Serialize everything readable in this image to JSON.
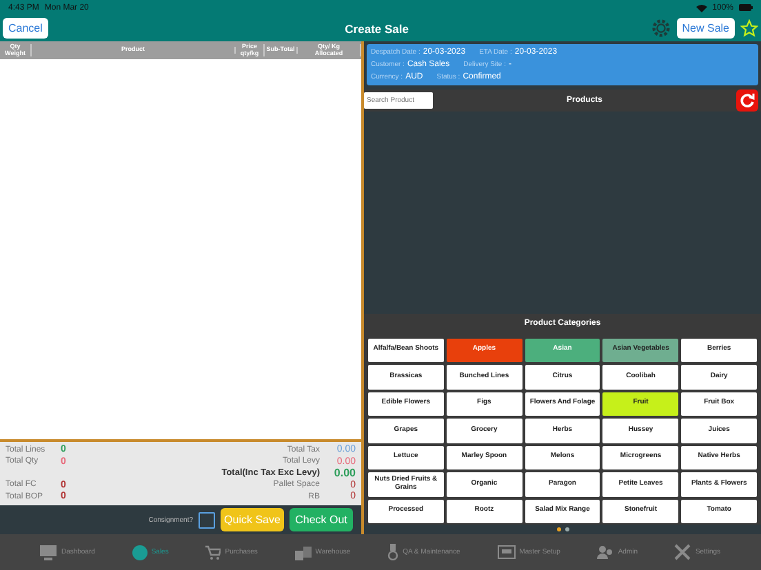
{
  "status_bar": {
    "time": "4:43 PM",
    "date": "Mon Mar 20",
    "battery_text": "100%"
  },
  "header": {
    "cancel": "Cancel",
    "title": "Create Sale",
    "new_sale": "New Sale"
  },
  "table": {
    "columns": [
      "Qty\nWeight",
      "Product",
      "Price\nqty/kg",
      "Sub-Total",
      "Qty/ Kg\nAllocated"
    ]
  },
  "totals": [
    {
      "left": {
        "label": "Total Lines",
        "value": "0",
        "color": "#2e9e5b"
      },
      "right": {
        "label": "Total Tax",
        "value": "0.00",
        "color": "#6a9fd8",
        "bold": false
      }
    },
    {
      "left": {
        "label": "Total Qty",
        "value": "0",
        "color": "#e8697a"
      },
      "right": {
        "label": "Total Levy",
        "value": "0.00",
        "color": "#e8697a",
        "bold": false
      }
    },
    {
      "right": {
        "label": "Total(Inc Tax Exc Levy)",
        "value": "0.00",
        "color": "#2e9e5b",
        "bold": true
      }
    },
    {
      "left": {
        "label": "Total FC",
        "value": "0",
        "color": "#b03030"
      },
      "right": {
        "label": "Pallet Space",
        "value": "0",
        "color": "#b03030",
        "bold": false
      }
    },
    {
      "left": {
        "label": "Total BOP",
        "value": "0",
        "color": "#b03030"
      },
      "right": {
        "label": "RB",
        "value": "0",
        "color": "#b03030",
        "bold": false
      }
    }
  ],
  "footer": {
    "consignment_label": "Consignment?",
    "consignment_checked": false,
    "quick_save": "Quick Save",
    "check_out": "Check Out"
  },
  "info": [
    [
      {
        "label": "Despatch Date :",
        "value": "20-03-2023"
      },
      {
        "label": "ETA Date :",
        "value": "20-03-2023"
      }
    ],
    [
      {
        "label": "Customer :",
        "value": "Cash Sales"
      },
      {
        "label": "Delivery Site :",
        "value": "-"
      }
    ],
    [
      {
        "label": "Currency :",
        "value": "AUD"
      },
      {
        "label": "Status :",
        "value": "Confirmed"
      }
    ]
  ],
  "products": {
    "search_placeholder": "Search Product",
    "title": "Products"
  },
  "categories": {
    "title": "Product Categories",
    "items": [
      {
        "label": "Alfalfa/Bean Shoots",
        "color": "#ffffff"
      },
      {
        "label": "Apples",
        "color": "#e8400c"
      },
      {
        "label": "Asian",
        "color": "#4caf7d"
      },
      {
        "label": "Asian Vegetables",
        "color": "#6fae90"
      },
      {
        "label": "Berries",
        "color": "#ffffff"
      },
      {
        "label": "Brassicas",
        "color": "#ffffff"
      },
      {
        "label": "Bunched Lines",
        "color": "#ffffff"
      },
      {
        "label": "Citrus",
        "color": "#ffffff"
      },
      {
        "label": "Coolibah",
        "color": "#ffffff"
      },
      {
        "label": "Dairy",
        "color": "#ffffff"
      },
      {
        "label": "Edible Flowers",
        "color": "#ffffff"
      },
      {
        "label": "Figs",
        "color": "#ffffff"
      },
      {
        "label": "Flowers And Folage",
        "color": "#ffffff"
      },
      {
        "label": "Fruit",
        "color": "#c6f01a"
      },
      {
        "label": "Fruit Box",
        "color": "#ffffff"
      },
      {
        "label": "Grapes",
        "color": "#ffffff"
      },
      {
        "label": "Grocery",
        "color": "#ffffff"
      },
      {
        "label": "Herbs",
        "color": "#ffffff"
      },
      {
        "label": "Hussey",
        "color": "#ffffff"
      },
      {
        "label": "Juices",
        "color": "#ffffff"
      },
      {
        "label": "Lettuce",
        "color": "#ffffff"
      },
      {
        "label": "Marley Spoon",
        "color": "#ffffff"
      },
      {
        "label": "Melons",
        "color": "#ffffff"
      },
      {
        "label": "Microgreens",
        "color": "#ffffff"
      },
      {
        "label": "Native Herbs",
        "color": "#ffffff"
      },
      {
        "label": "Nuts Dried Fruits & Grains",
        "color": "#ffffff"
      },
      {
        "label": "Organic",
        "color": "#ffffff"
      },
      {
        "label": "Paragon",
        "color": "#ffffff"
      },
      {
        "label": "Petite Leaves",
        "color": "#ffffff"
      },
      {
        "label": "Plants & Flowers",
        "color": "#ffffff"
      },
      {
        "label": "Processed",
        "color": "#ffffff"
      },
      {
        "label": "Rootz",
        "color": "#ffffff"
      },
      {
        "label": "Salad Mix Range",
        "color": "#ffffff"
      },
      {
        "label": "Stonefruit",
        "color": "#ffffff"
      },
      {
        "label": "Tomato",
        "color": "#ffffff"
      }
    ],
    "pages": [
      {
        "selected": true
      },
      {
        "selected": false
      }
    ]
  },
  "tab_bar": [
    {
      "label": "Dashboard",
      "selected": false
    },
    {
      "label": "Sales",
      "selected": true
    },
    {
      "label": "Purchases",
      "selected": false
    },
    {
      "label": "Warehouse",
      "selected": false
    },
    {
      "label": "QA & Maintenance",
      "selected": false
    },
    {
      "label": "Master Setup",
      "selected": false
    },
    {
      "label": "Admin",
      "selected": false
    },
    {
      "label": "Settings",
      "selected": false
    }
  ]
}
